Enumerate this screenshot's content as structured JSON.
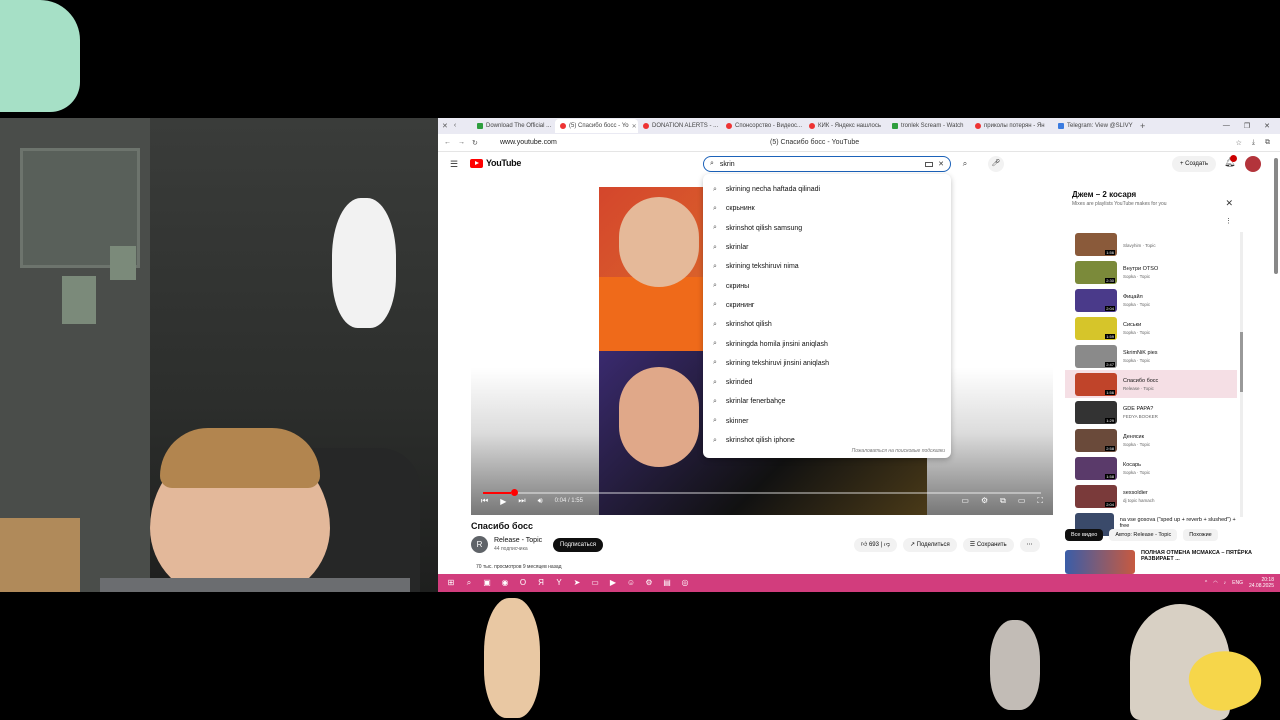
{
  "browser": {
    "tabs": [
      {
        "label": "Download The Official ..."
      },
      {
        "label": "(5) Спасибо босс - Yo",
        "active": true
      },
      {
        "label": "DONATION ALERTS - ..."
      },
      {
        "label": "Спонсорство - Видеос..."
      },
      {
        "label": "КИК - Яндекс нашлось"
      },
      {
        "label": "tronlek Scream - Watch"
      },
      {
        "label": "приколы потерян - Ян"
      },
      {
        "label": "Telegram: View @SLIVY"
      }
    ],
    "url": "www.youtube.com",
    "page_title": "(5) Спасибо босс - YouTube"
  },
  "youtube": {
    "logo": "YouTube",
    "search_value": "skrin",
    "create_label": "Создать",
    "suggestions": [
      "skrining necha haftada qilinadi",
      "скрьнинк",
      "skrinshot qilish samsung",
      "skrinlar",
      "skrining tekshiruvi nima",
      "скрины",
      "скрининг",
      "skrinshot qilish",
      "skriningda homila jinsini aniqlash",
      "skrining tekshiruvi jinsini aniqlash",
      "skrinded",
      "skrinlar fenerbahçe",
      "skinner",
      "skrinshot qilish iphone"
    ],
    "report_label": "Пожаловаться на поисковые подсказки",
    "video": {
      "title": "Спасибо босс",
      "channel": "Release - Topic",
      "channel_initial": "R",
      "subs": "44 подписчика",
      "subscribe_label": "Подписаться",
      "likes": "693",
      "share_label": "Поделиться",
      "save_label": "Сохранить",
      "views": "70 тыс. просмотров  9 месяцев назад",
      "time": "0:04 / 1:55",
      "progress": 0.05
    },
    "playlist": {
      "title": "Джем – 2 косаря",
      "subtitle": "Mixes are playlists YouTube makes for you",
      "items": [
        {
          "title": "",
          "artist": "Slavyhim · Topic",
          "dur": "1:56",
          "color": "#8a5a3a"
        },
        {
          "title": "Внутри OTSO",
          "artist": "Sopka · Topic",
          "dur": "2:30",
          "color": "#7b8a3a"
        },
        {
          "title": "Фицайл",
          "artist": "Sopka · Topic",
          "dur": "2:04",
          "color": "#4a3a8a"
        },
        {
          "title": "Сиськи",
          "artist": "Sopka · Topic",
          "dur": "1:59",
          "color": "#d6c52a"
        },
        {
          "title": "SkrimNiK pies",
          "artist": "Sopka · Topic",
          "dur": "2:47",
          "color": "#8a8a8a"
        },
        {
          "title": "Спасибо босс",
          "artist": "Release · Topic",
          "dur": "1:56",
          "color": "#c0442a",
          "now": true
        },
        {
          "title": "GDE PAPA?",
          "artist": "FEDYA BOOKER",
          "dur": "1:29",
          "color": "#333333"
        },
        {
          "title": "Денясик",
          "artist": "Sopka · Topic",
          "dur": "2:58",
          "color": "#6a4a3a"
        },
        {
          "title": "Косарь",
          "artist": "Sopka · Topic",
          "dur": "1:58",
          "color": "#5a3a6a"
        },
        {
          "title": "sexsoldier",
          "artist": "dj topic hamach",
          "dur": "2:04",
          "color": "#7a3a3a"
        },
        {
          "title": "na vse gosova (\"sped up + reverb + slushed\") + free",
          "artist": "",
          "dur": "",
          "color": "#3a4a6a"
        }
      ]
    },
    "filters": [
      "Все видео",
      "Автор: Release - Topic",
      "Похожие"
    ],
    "rec_title": "ПОЛНАЯ ОТМЕНА МСМАКСА – ПЯТЁРКА РАЗВИРАЕТ ..."
  },
  "taskbar": {
    "lang": "ENG",
    "time": "20:18",
    "date": "24.08.2025"
  },
  "colors": {
    "taskbar": "#d23d7d",
    "accent_red": "#ff0000",
    "now_playing": "#f5dfe5"
  }
}
